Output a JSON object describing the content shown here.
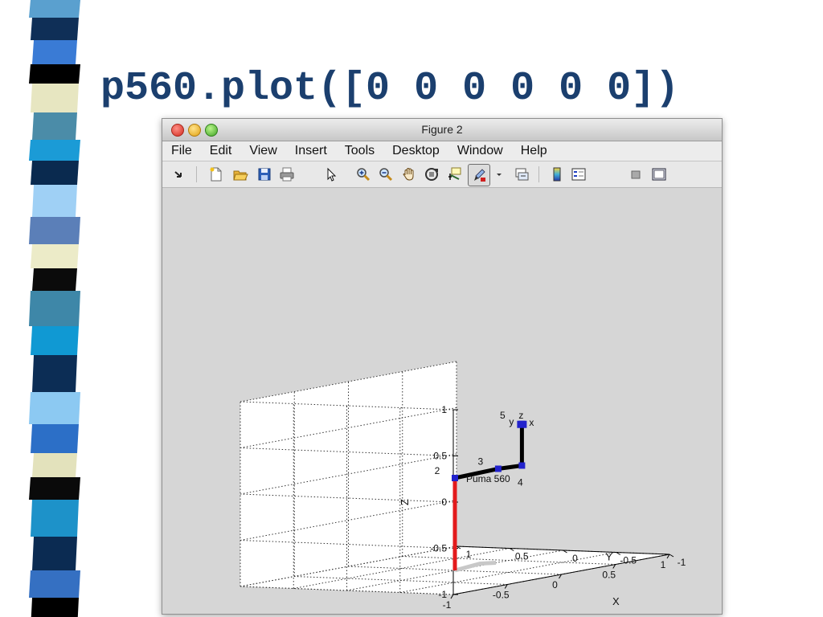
{
  "slide": {
    "title": "p560.plot([0 0 0 0 0 0])"
  },
  "window": {
    "title": "Figure 2"
  },
  "menu": [
    "File",
    "Edit",
    "View",
    "Insert",
    "Tools",
    "Desktop",
    "Window",
    "Help"
  ],
  "toolbar": [
    {
      "icon": "arrow-icon"
    },
    {
      "icon": "new-figure-icon"
    },
    {
      "icon": "open-file-icon"
    },
    {
      "icon": "save-icon"
    },
    {
      "icon": "print-icon"
    },
    {
      "icon": "pointer-icon"
    },
    {
      "icon": "zoom-in-icon"
    },
    {
      "icon": "zoom-out-icon"
    },
    {
      "icon": "pan-hand-icon"
    },
    {
      "icon": "rotate-3d-icon"
    },
    {
      "icon": "data-cursor-icon"
    },
    {
      "icon": "brush-icon"
    },
    {
      "icon": "brush-dropdown-icon"
    },
    {
      "icon": "link-plot-icon"
    },
    {
      "icon": "colorbar-icon"
    },
    {
      "icon": "legend-icon"
    },
    {
      "icon": "hide-plot-tools-icon"
    },
    {
      "icon": "show-plot-tools-icon"
    }
  ],
  "chart_data": {
    "type": "3d-line",
    "title": "",
    "xlabel": "X",
    "ylabel": "Y",
    "zlabel": "Z",
    "xlim": [
      -1,
      1
    ],
    "ylim": [
      -1,
      1
    ],
    "zlim": [
      -1,
      1
    ],
    "xticks": [
      "-1",
      "-0.5",
      "0",
      "0.5",
      "1"
    ],
    "yticks": [
      "-1",
      "-0.5",
      "0",
      "0.5",
      "1"
    ],
    "zticks": [
      "-1",
      "-0.5",
      "0",
      "0.5",
      "1"
    ],
    "grid": true,
    "robot_name": "Puma 560",
    "joint_labels": [
      "2",
      "3",
      "4",
      "5"
    ],
    "wrist_axis_labels": [
      "y",
      "z",
      "x"
    ],
    "colors": {
      "base_link": "#e31a1c",
      "arm_links": "#000000",
      "joints": "#2222cc",
      "shadow": "#c8c8c8"
    }
  }
}
